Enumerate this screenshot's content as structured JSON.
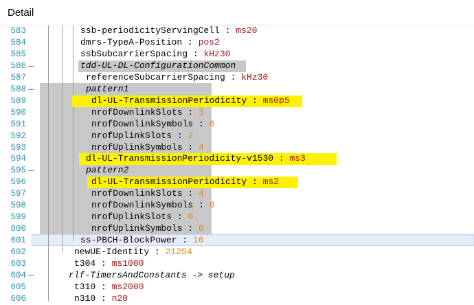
{
  "window": {
    "title": "Detail"
  },
  "editor": {
    "lines": [
      {
        "num": "583",
        "indent": 117,
        "key": "ssb-periodicityServingCell",
        "sep": " : ",
        "val": "ms20",
        "type": "v",
        "fold": false
      },
      {
        "num": "584",
        "indent": 117,
        "key": "dmrs-TypeA-Position",
        "sep": " : ",
        "val": "pos2",
        "type": "v",
        "fold": false
      },
      {
        "num": "585",
        "indent": 117,
        "key": "ssbSubcarrierSpacing",
        "sep": " : ",
        "val": "kHz30",
        "type": "v",
        "fold": false
      },
      {
        "num": "586",
        "indent": 117,
        "key": "tdd-UL-DL-ConfigurationCommon",
        "sep": "",
        "val": "",
        "type": "it",
        "fold": true
      },
      {
        "num": "587",
        "indent": 125,
        "key": "referenceSubcarrierSpacing",
        "sep": " : ",
        "val": "kHz30",
        "type": "v",
        "fold": false
      },
      {
        "num": "588",
        "indent": 125,
        "key": "pattern1",
        "sep": "",
        "val": "",
        "type": "it",
        "fold": true
      },
      {
        "num": "589",
        "indent": 133,
        "key": "dl-UL-TransmissionPeriodicity",
        "sep": " : ",
        "val": "ms0p5",
        "type": "v",
        "fold": false
      },
      {
        "num": "590",
        "indent": 133,
        "key": "nrofDownlinkSlots",
        "sep": " : ",
        "val": "3",
        "type": "n",
        "fold": false
      },
      {
        "num": "591",
        "indent": 133,
        "key": "nrofDownlinkSymbols",
        "sep": " : ",
        "val": "6",
        "type": "n",
        "fold": false
      },
      {
        "num": "592",
        "indent": 133,
        "key": "nrofUplinkSlots",
        "sep": " : ",
        "val": "2",
        "type": "n",
        "fold": false
      },
      {
        "num": "593",
        "indent": 133,
        "key": "nrofUplinkSymbols",
        "sep": " : ",
        "val": "4",
        "type": "n",
        "fold": false
      },
      {
        "num": "594",
        "indent": 125,
        "key": "dl-UL-TransmissionPeriodicity-v1530",
        "sep": " : ",
        "val": "ms3",
        "type": "v",
        "fold": false
      },
      {
        "num": "595",
        "indent": 125,
        "key": "pattern2",
        "sep": "",
        "val": "",
        "type": "it",
        "fold": true
      },
      {
        "num": "596",
        "indent": 133,
        "key": "dl-UL-TransmissionPeriodicity",
        "sep": " : ",
        "val": "ms2",
        "type": "v",
        "fold": false
      },
      {
        "num": "597",
        "indent": 133,
        "key": "nrofDownlinkSlots",
        "sep": " : ",
        "val": "4",
        "type": "n",
        "fold": false
      },
      {
        "num": "598",
        "indent": 133,
        "key": "nrofDownlinkSymbols",
        "sep": " : ",
        "val": "0",
        "type": "n",
        "fold": false
      },
      {
        "num": "599",
        "indent": 133,
        "key": "nrofUplinkSlots",
        "sep": " : ",
        "val": "0",
        "type": "n",
        "fold": false
      },
      {
        "num": "600",
        "indent": 133,
        "key": "nrofUplinkSymbols",
        "sep": " : ",
        "val": "0",
        "type": "n",
        "fold": false
      },
      {
        "num": "601",
        "indent": 117,
        "key": "ss-PBCH-BlockPower",
        "sep": " : ",
        "val": "16",
        "type": "n",
        "fold": false
      },
      {
        "num": "602",
        "indent": 108,
        "key": "newUE-Identity",
        "sep": " : ",
        "val": "21254",
        "type": "n",
        "fold": false
      },
      {
        "num": "603",
        "indent": 108,
        "key": "t304",
        "sep": " : ",
        "val": "ms1000",
        "type": "v",
        "fold": false
      },
      {
        "num": "604",
        "indent": 100,
        "key": "rlf-TimersAndConstants -> setup",
        "sep": "",
        "val": "",
        "type": "it",
        "fold": true
      },
      {
        "num": "605",
        "indent": 108,
        "key": "t310",
        "sep": " : ",
        "val": "ms2000",
        "type": "v",
        "fold": false
      },
      {
        "num": "606",
        "indent": 108,
        "key": "n310",
        "sep": " : ",
        "val": "n20",
        "type": "v",
        "fold": false
      }
    ]
  },
  "colors": {
    "selection": "#c8c8c8",
    "highlight": "#fff100",
    "line_number": "#2b91af",
    "value_text": "#a31515",
    "number_text": "#e0881a"
  }
}
